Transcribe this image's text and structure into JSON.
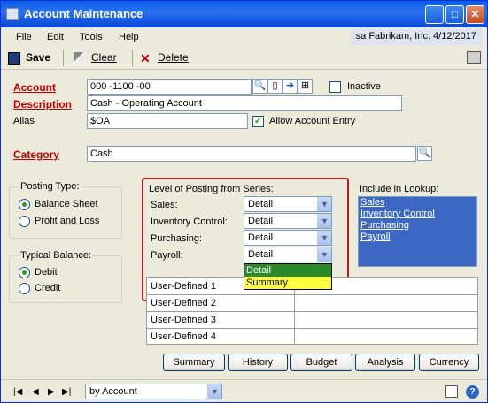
{
  "window": {
    "title": "Account Maintenance"
  },
  "menu": {
    "items": [
      "File",
      "Edit",
      "Tools",
      "Help"
    ],
    "info": "sa  Fabrikam, Inc.  4/12/2017"
  },
  "toolbar": {
    "save_label": "Save",
    "clear_label": "Clear",
    "delete_label": "Delete"
  },
  "form": {
    "account_label": "Account",
    "account_value": "000 -1100 -00",
    "inactive_label": "Inactive",
    "description_label": "Description",
    "description_value": "Cash - Operating Account",
    "alias_label": "Alias",
    "alias_value": "$OA",
    "allow_entry_label": "Allow Account Entry",
    "category_label": "Category",
    "category_value": "Cash"
  },
  "posting_type": {
    "title": "Posting Type:",
    "options": [
      "Balance Sheet",
      "Profit and Loss"
    ],
    "selected": "Balance Sheet"
  },
  "typical_balance": {
    "title": "Typical Balance:",
    "options": [
      "Debit",
      "Credit"
    ],
    "selected": "Debit"
  },
  "level_posting": {
    "title": "Level of Posting from Series:",
    "rows": [
      {
        "label": "Sales:",
        "value": "Detail"
      },
      {
        "label": "Inventory Control:",
        "value": "Detail"
      },
      {
        "label": "Purchasing:",
        "value": "Detail"
      },
      {
        "label": "Payroll:",
        "value": "Detail"
      }
    ],
    "dropdown_options": [
      "Detail",
      "Summary"
    ]
  },
  "include_lookup": {
    "title": "Include in Lookup:",
    "items": [
      "Sales",
      "Inventory Control",
      "Purchasing",
      "Payroll"
    ]
  },
  "user_defined": {
    "labels": [
      "User-Defined 1",
      "User-Defined 2",
      "User-Defined 3",
      "User-Defined 4"
    ]
  },
  "buttons": {
    "summary": "Summary",
    "history": "History",
    "budget": "Budget",
    "analysis": "Analysis",
    "currency": "Currency"
  },
  "bottom": {
    "sort_value": "by Account"
  }
}
